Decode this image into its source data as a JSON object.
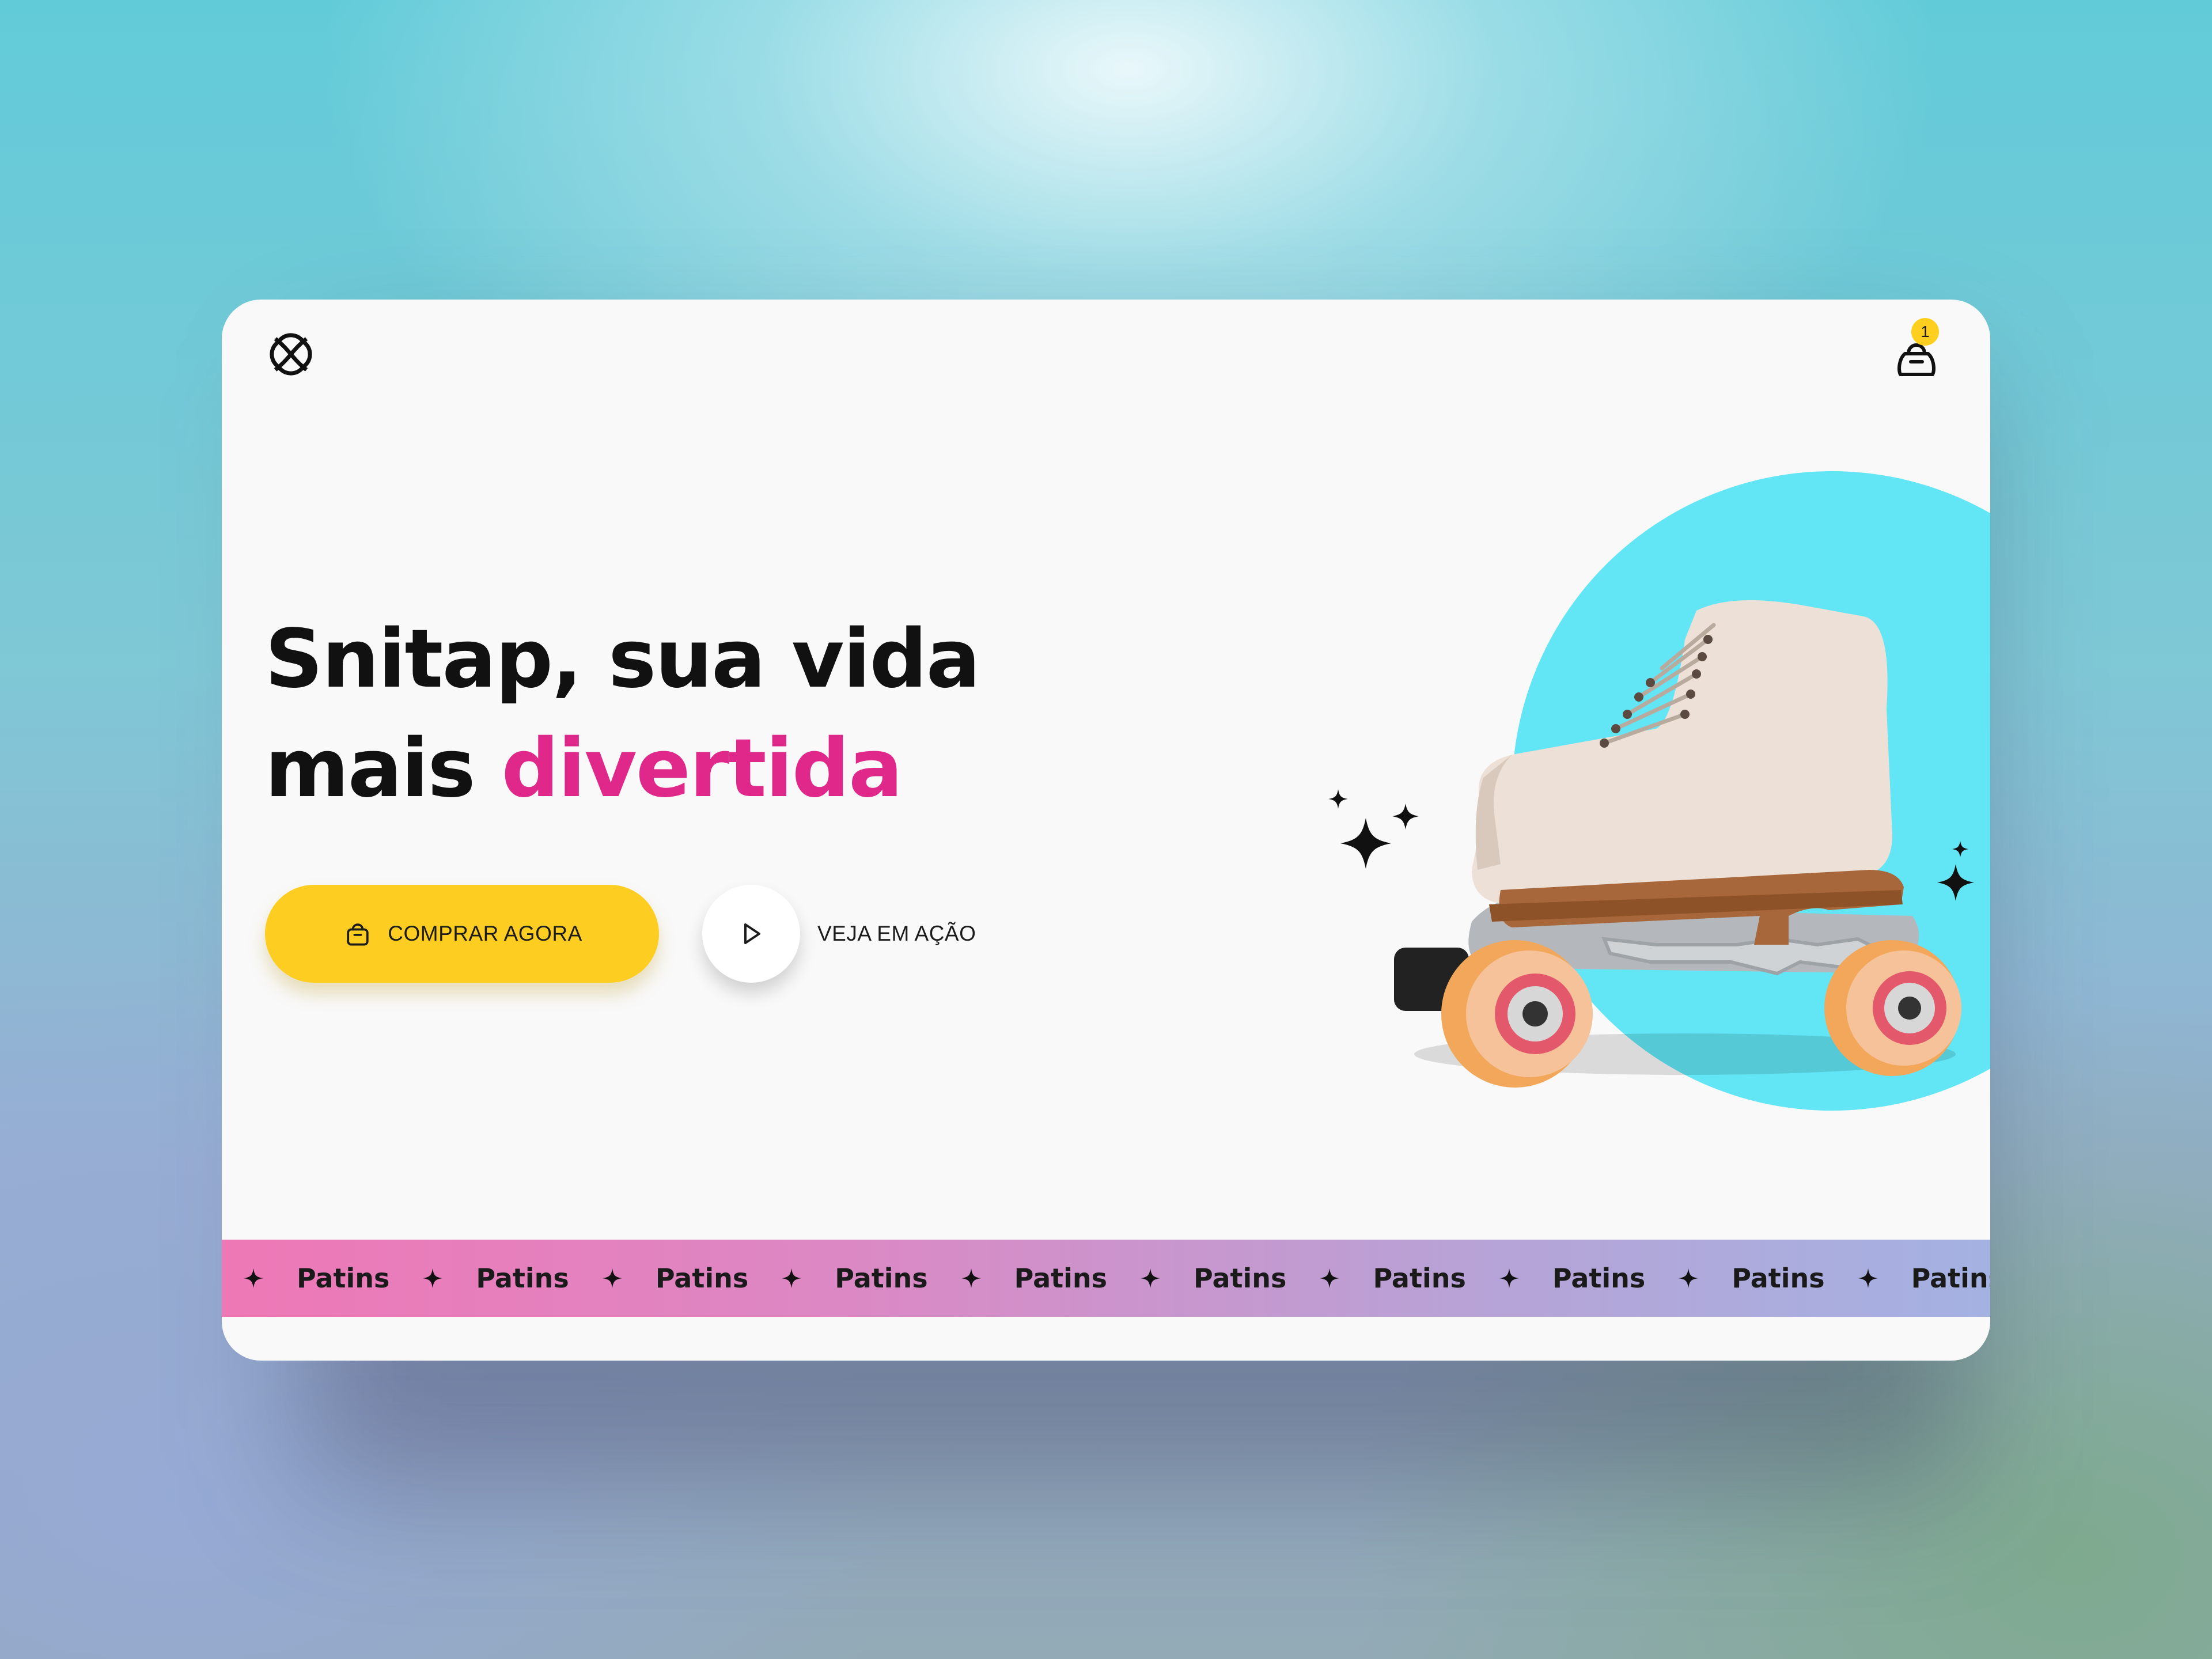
{
  "header": {
    "logo_icon": "brand-logo-icon",
    "cart_icon": "shopping-bag-icon",
    "cart_count": "1"
  },
  "hero": {
    "title_line1": "Snitap, sua vida",
    "title_line2_plain": "mais",
    "title_line2_accent": "divertida",
    "accent_color": "#e0288a"
  },
  "actions": {
    "buy_label": "COMPRAR AGORA",
    "buy_icon": "shopping-bag-icon",
    "buy_color": "#fecd21",
    "watch_label": "VEJA EM AÇÃO",
    "watch_icon": "play-icon"
  },
  "product": {
    "image": "roller-skate",
    "circle_color": "#62e5f5",
    "decor_icon": "sparkle-icon"
  },
  "marquee": {
    "word": "Patins",
    "separator_icon": "sparkle-icon"
  }
}
